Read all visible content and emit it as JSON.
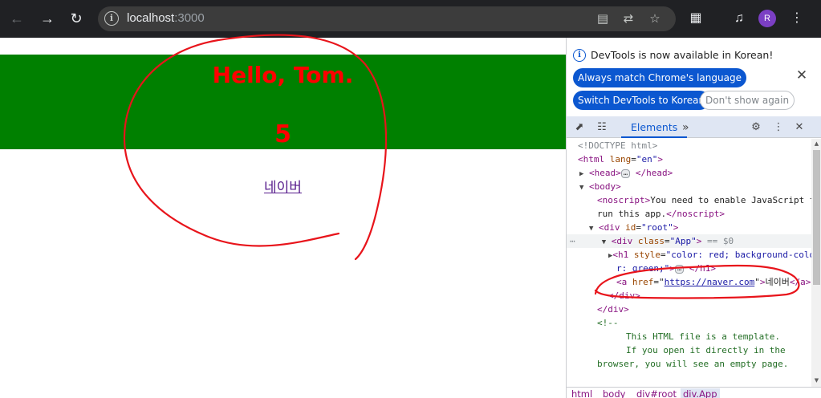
{
  "browser": {
    "url_host": "localhost",
    "url_port": ":3000",
    "avatar_letter": "R",
    "icons": [
      "back-arrow-icon",
      "forward-arrow-icon",
      "reload-icon",
      "site-info-icon",
      "install-app-icon",
      "translate-icon",
      "bookmark-star-icon",
      "extensions-icon",
      "media-queue-icon",
      "profile-avatar",
      "kebab-menu-icon"
    ]
  },
  "page": {
    "heading_line1": "Hello, Tom.",
    "heading_line2": "5",
    "link_text": "네이버",
    "heading_color": "#ff0000",
    "heading_background": "#008000"
  },
  "devtools": {
    "banner_text": "DevTools is now available in Korean!",
    "btn_always_match": "Always match Chrome's language",
    "btn_switch": "Switch DevTools to Korean",
    "btn_dont_show": "Don't show again",
    "tab_elements": "Elements",
    "dom": {
      "doctype": "<!DOCTYPE html>",
      "html_open_tag": "html",
      "html_attr": "lang",
      "html_attr_val": "\"en\"",
      "head": "head",
      "body": "body",
      "noscript_text_1": "You need to enable JavaScript to",
      "noscript_text_2": "run this app.",
      "noscript_tag": "noscript",
      "div_root_attr": "id",
      "div_root_val": "\"root\"",
      "div_app_attr": "class",
      "div_app_val": "\"App\"",
      "dollar_zero": "== $0",
      "h1_attr": "style",
      "h1_val_1": "\"color: red; background-colo",
      "h1_val_2": "r: green;\"",
      "a_attr": "href",
      "a_href": "https://naver.com",
      "a_text": "네이버",
      "div_close": "div",
      "comment_open": "<!--",
      "comment_1": "This HTML file is a template.",
      "comment_2": "If you open it directly in the",
      "comment_3": "browser, you will see an empty page."
    },
    "breadcrumbs": [
      "html",
      "body",
      "div#root",
      "div.App"
    ]
  },
  "annotation_color": "#e8141b"
}
